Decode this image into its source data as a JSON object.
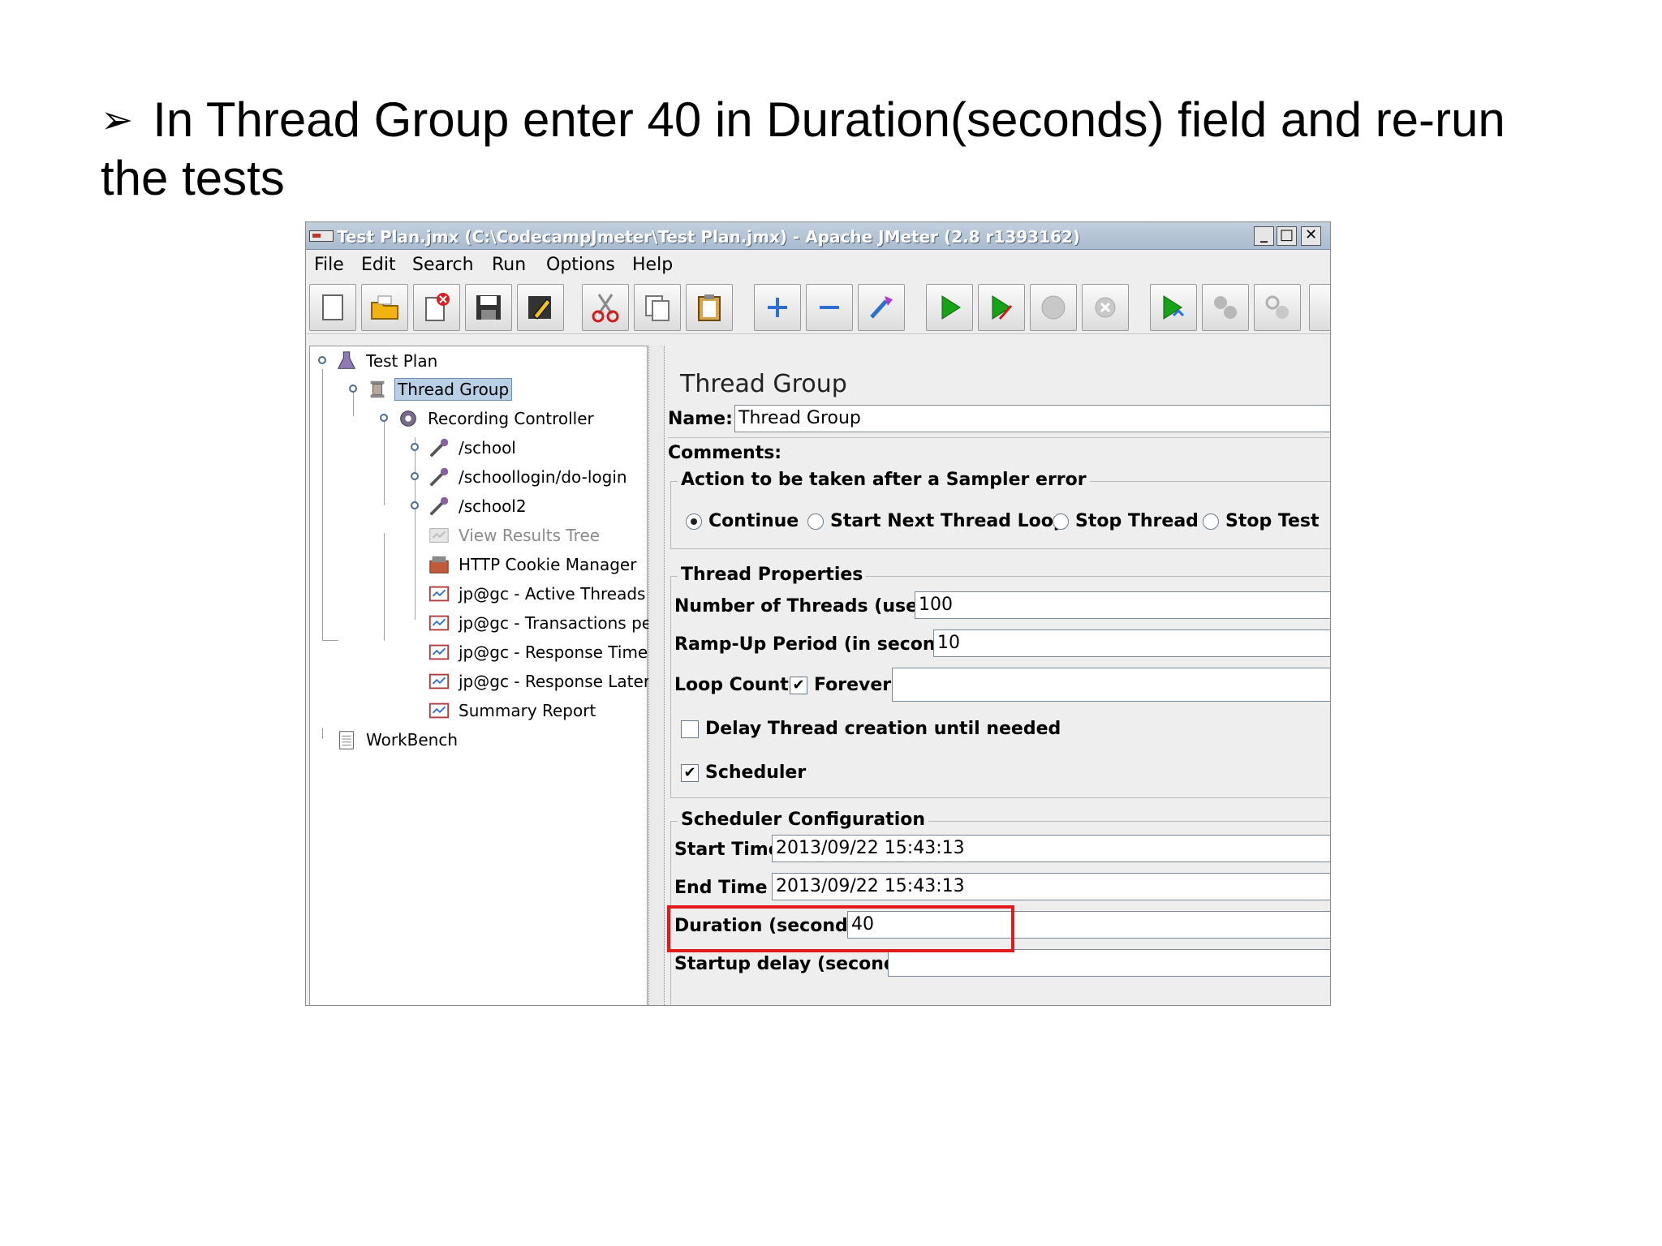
{
  "caption": {
    "bullet": "➢",
    "text": "In Thread Group enter 40 in Duration(seconds) field and re-run the tests"
  },
  "window": {
    "title": "Test Plan.jmx (C:\\CodecampJmeter\\Test Plan.jmx) - Apache JMeter (2.8 r1393162)",
    "minimize": "_",
    "maximize": "□",
    "close": "✕"
  },
  "menu": {
    "file": "File",
    "edit": "Edit",
    "search": "Search",
    "run": "Run",
    "options": "Options",
    "help": "Help"
  },
  "toolbar": {
    "icons": [
      "new-icon",
      "open-icon",
      "close-icon",
      "save-icon",
      "edit-icon",
      "cut-icon",
      "copy-icon",
      "paste-icon",
      "expand-icon",
      "collapse-icon",
      "toggle-icon",
      "start-icon",
      "start-no-pauses-icon",
      "stop-icon",
      "shutdown-icon",
      "remote-start-icon",
      "remote-stop-icon",
      "remote-shutdown-icon"
    ]
  },
  "tree": {
    "test_plan": "Test Plan",
    "thread_group": "Thread Group",
    "recording_controller": "Recording Controller",
    "school": "/school",
    "school_login": "/schoollogin/do-login",
    "school2": "/school2",
    "view_results_tree": "View Results Tree",
    "cookie_manager": "HTTP Cookie Manager",
    "active_threads": "jp@gc - Active Threads",
    "transactions": "jp@gc - Transactions pe",
    "response_times": "jp@gc - Response Times",
    "response_latency": "jp@gc - Response Later",
    "summary_report": "Summary Report",
    "workbench": "WorkBench"
  },
  "panel": {
    "title": "Thread Group",
    "name_label": "Name:",
    "name_value": "Thread Group",
    "comments_label": "Comments:",
    "action_title": "Action to be taken after a Sampler error",
    "action_options": {
      "continue": "Continue",
      "start_next": "Start Next Thread Loop",
      "stop_thread": "Stop Thread",
      "stop_test": "Stop Test"
    },
    "action_selected": "Continue",
    "thread_props_title": "Thread Properties",
    "threads_label": "Number of Threads (users):",
    "threads_value": "100",
    "rampup_label": "Ramp-Up Period (in seconds):",
    "rampup_value": "10",
    "loop_label": "Loop Count:",
    "forever_label": "Forever",
    "forever_checked": true,
    "delay_label": "Delay Thread creation until needed",
    "delay_checked": false,
    "scheduler_label": "Scheduler",
    "scheduler_checked": true,
    "sched_title": "Scheduler Configuration",
    "start_label": "Start Time",
    "start_value": "2013/09/22 15:43:13",
    "end_label": "End Time",
    "end_value": "2013/09/22 15:43:13",
    "duration_label": "Duration (seconds)",
    "duration_value": "40",
    "startup_label": "Startup delay (seconds)",
    "startup_value": "",
    "check_mark": "✔"
  },
  "colors": {
    "highlight": "#e11b1b",
    "selection": "#b8cfe5"
  }
}
